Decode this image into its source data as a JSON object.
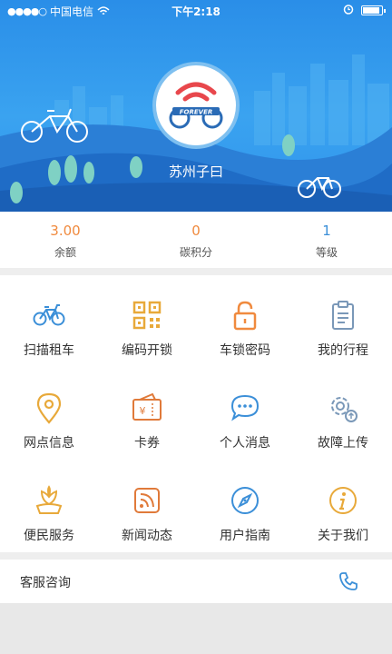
{
  "status_bar": {
    "signal": "●●●●○",
    "carrier": "中国电信",
    "time": "下午2:18"
  },
  "brand": {
    "logo_text": "FOREVER"
  },
  "user": {
    "name": "苏州子曰"
  },
  "stats": [
    {
      "value": "3.00",
      "label": "余额"
    },
    {
      "value": "0",
      "label": "碳积分"
    },
    {
      "value": "1",
      "label": "等级"
    }
  ],
  "menu": [
    {
      "label": "扫描租车",
      "icon": "bicycle-icon"
    },
    {
      "label": "编码开锁",
      "icon": "qr-code-icon"
    },
    {
      "label": "车锁密码",
      "icon": "lock-icon"
    },
    {
      "label": "我的行程",
      "icon": "clipboard-icon"
    },
    {
      "label": "网点信息",
      "icon": "location-pin-icon"
    },
    {
      "label": "卡券",
      "icon": "coupon-icon"
    },
    {
      "label": "个人消息",
      "icon": "chat-bubble-icon"
    },
    {
      "label": "故障上传",
      "icon": "gear-upload-icon"
    },
    {
      "label": "便民服务",
      "icon": "flower-icon"
    },
    {
      "label": "新闻动态",
      "icon": "rss-icon"
    },
    {
      "label": "用户指南",
      "icon": "compass-icon"
    },
    {
      "label": "关于我们",
      "icon": "info-icon"
    }
  ],
  "service": {
    "label": "客服咨询",
    "icon": "phone-icon"
  },
  "colors": {
    "blue": "#3b8fd8",
    "orange": "#f08a3e",
    "gold": "#e8a93a",
    "grey_blue": "#7a98b8"
  }
}
